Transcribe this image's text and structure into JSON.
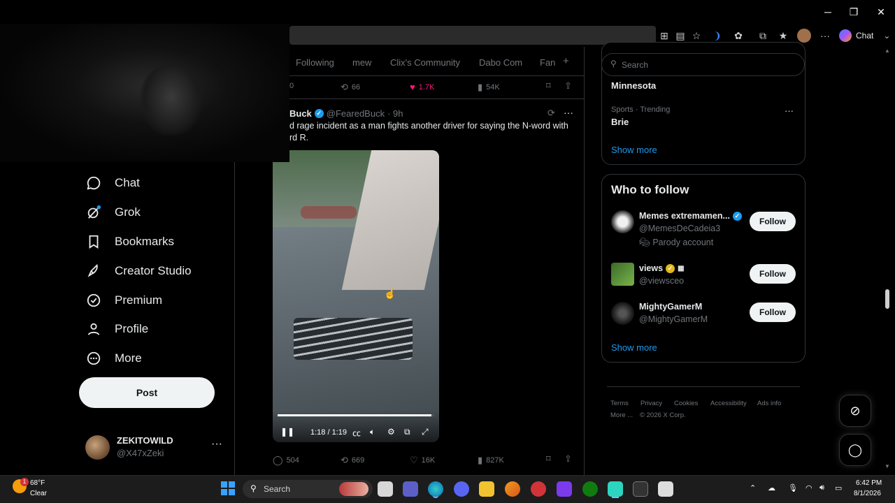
{
  "browser": {
    "copilot_label": "Chat",
    "window_controls": [
      "─",
      "❐",
      "✕"
    ]
  },
  "nav": {
    "items": [
      {
        "label": "Chat",
        "icon": "chat-bubble-icon"
      },
      {
        "label": "Grok",
        "icon": "grok-icon"
      },
      {
        "label": "Bookmarks",
        "icon": "bookmark-icon"
      },
      {
        "label": "Creator Studio",
        "icon": "rocket-icon"
      },
      {
        "label": "Premium",
        "icon": "verified-badge-icon"
      },
      {
        "label": "Profile",
        "icon": "person-icon"
      },
      {
        "label": "More",
        "icon": "more-circle-icon"
      }
    ],
    "post_label": "Post",
    "account": {
      "name": "ZEKITOWILD",
      "handle": "@X47xZeki",
      "more": "···"
    }
  },
  "timeline": {
    "tabs": [
      "Following",
      "mew",
      "Clix's Community",
      "Dabo Com",
      "Fan",
      "+"
    ],
    "prev_stats": {
      "replies": "0",
      "reposts": "66",
      "likes": "1.7K",
      "views": "54K"
    },
    "tweet": {
      "name": "Buck",
      "handle": "@FearedBuck",
      "time": "· 9h",
      "text": "d rage incident as a man fights another driver for saying the N-word with",
      "text2": "rd R.",
      "video": {
        "time": "1:18 / 1:19",
        "progress": 0.98
      },
      "stats": {
        "replies": "504",
        "reposts": "669",
        "likes": "16K",
        "views": "827K"
      }
    }
  },
  "right": {
    "search_placeholder": "Search",
    "trends": [
      {
        "meta": "",
        "title": "Minnesota"
      },
      {
        "meta": "Sports · Trending",
        "title": "Brie",
        "more": "···"
      }
    ],
    "trends_show_more": "Show more",
    "who_to_follow": {
      "title": "Who to follow",
      "users": [
        {
          "name": "Memes extremamen...",
          "handle": "@MemesDeCadeia3",
          "extra": "Parody account",
          "follow": "Follow"
        },
        {
          "name": "views",
          "handle": "@viewsceo",
          "follow": "Follow"
        },
        {
          "name": "MightyGamerM",
          "handle": "@MightyGamerM",
          "follow": "Follow"
        }
      ],
      "show_more": "Show more"
    },
    "footer": {
      "links": [
        "Terms",
        "Privacy",
        "Cookies",
        "Accessibility",
        "Ads info"
      ],
      "more": "More ...",
      "copyright": "© 2026 X Corp."
    }
  },
  "taskbar": {
    "weather": {
      "temp": "68°F",
      "cond": "Clear",
      "badge": "1"
    },
    "search_placeholder": "Search",
    "time": "6:42 PM",
    "date": "8/1/2026"
  },
  "colors": {
    "accent": "#1d9bf0",
    "like": "#f91880",
    "background": "#000000"
  }
}
